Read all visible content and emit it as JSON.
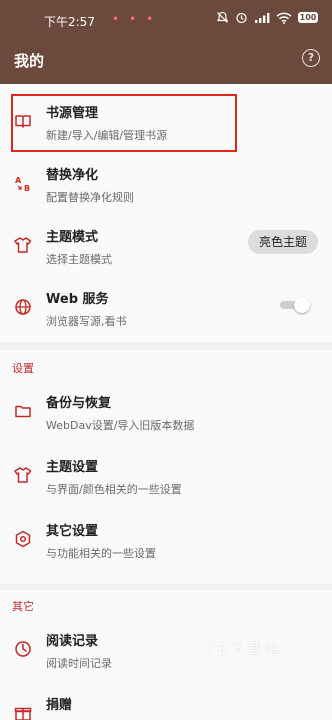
{
  "status_bar": {
    "time": "下午2:57",
    "battery": "100"
  },
  "header": {
    "title": "我的",
    "help_icon": "?"
  },
  "colors": {
    "header_bg": "#6b4a3d",
    "accent": "#c62828",
    "highlight_border": "#e0261f"
  },
  "items": {
    "book_source": {
      "title": "书源管理",
      "subtitle": "新建/导入/编辑/管理书源",
      "icon": "book-icon"
    },
    "replace": {
      "title": "替换净化",
      "subtitle": "配置替换净化规则",
      "icon": "replace-icon"
    },
    "theme_mode": {
      "title": "主题模式",
      "subtitle": "选择主题模式",
      "icon": "shirt-icon",
      "value": "亮色主题"
    },
    "web_service": {
      "title": "Web 服务",
      "subtitle": "浏览器写源,看书",
      "icon": "globe-icon",
      "enabled": false
    }
  },
  "section_settings": {
    "label": "设置",
    "backup": {
      "title": "备份与恢复",
      "subtitle": "WebDav设置/导入旧版本数据",
      "icon": "folder-icon"
    },
    "theme_settings": {
      "title": "主题设置",
      "subtitle": "与界面/颜色相关的一些设置",
      "icon": "shirt-icon"
    },
    "other_settings": {
      "title": "其它设置",
      "subtitle": "与功能相关的一些设置",
      "icon": "settings-icon"
    }
  },
  "section_other": {
    "label": "其它",
    "read_record": {
      "title": "阅读记录",
      "subtitle": "阅读时间记录",
      "icon": "clock-icon"
    },
    "donate": {
      "title": "捐赠",
      "icon": "gift-icon"
    }
  },
  "watermark": "7B下载站"
}
